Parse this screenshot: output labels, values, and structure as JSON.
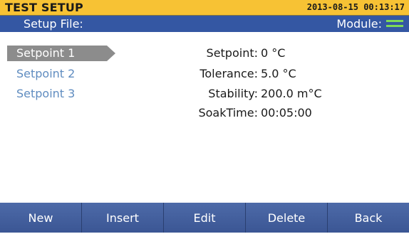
{
  "header": {
    "title": "TEST SETUP",
    "datetime": "2013-08-15 00:13:17"
  },
  "subheader": {
    "setup_file_label": "Setup File:",
    "module_label": "Module:",
    "module_icon": "module-status-icon",
    "module_icon_color": "#7ed957"
  },
  "setpoints": [
    {
      "label": "Setpoint 1",
      "selected": true
    },
    {
      "label": "Setpoint 2",
      "selected": false
    },
    {
      "label": "Setpoint 3",
      "selected": false
    }
  ],
  "details": {
    "setpoint_label": "Setpoint:",
    "setpoint_value": "0 °C",
    "tolerance_label": "Tolerance:",
    "tolerance_value": "5.0 °C",
    "stability_label": "Stability:",
    "stability_value": "200.0 m°C",
    "soaktime_label": "SoakTime:",
    "soaktime_value": "00:05:00"
  },
  "footer": {
    "buttons": [
      "New",
      "Insert",
      "Edit",
      "Delete",
      "Back"
    ]
  },
  "colors": {
    "title_bar": "#f7c234",
    "subheader": "#3457a3",
    "footer": "#3e5a99",
    "selected_item": "#8c8c8c",
    "unselected_item_text": "#5f8cc0"
  }
}
